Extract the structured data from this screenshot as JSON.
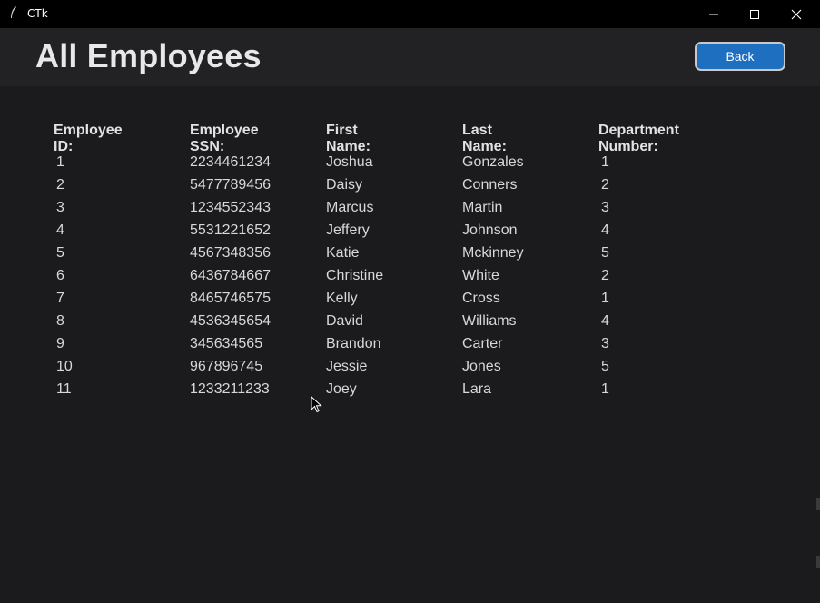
{
  "window": {
    "title": "CTk"
  },
  "header": {
    "title": "All Employees",
    "back_label": "Back"
  },
  "table": {
    "columns": [
      "Employee ID:",
      "Employee SSN:",
      "First Name:",
      "Last Name:",
      "Department Number:"
    ],
    "rows": [
      [
        "1",
        "2234461234",
        "Joshua",
        "Gonzales",
        "1"
      ],
      [
        "2",
        "5477789456",
        "Daisy",
        "Conners",
        "2"
      ],
      [
        "3",
        "1234552343",
        "Marcus",
        "Martin",
        "3"
      ],
      [
        "4",
        "5531221652",
        "Jeffery",
        "Johnson",
        "4"
      ],
      [
        "5",
        "4567348356",
        "Katie",
        "Mckinney",
        "5"
      ],
      [
        "6",
        "6436784667",
        "Christine",
        "White",
        "2"
      ],
      [
        "7",
        "8465746575",
        "Kelly",
        "Cross",
        "1"
      ],
      [
        "8",
        "4536345654",
        "David",
        "Williams",
        "4"
      ],
      [
        "9",
        "345634565",
        "Brandon",
        "Carter",
        "3"
      ],
      [
        "10",
        "967896745",
        "Jessie",
        "Jones",
        "5"
      ],
      [
        "11",
        "1233211233",
        "Joey",
        "Lara",
        "1"
      ]
    ]
  },
  "colors": {
    "background": "#1b1b1d",
    "header": "#222224",
    "accent": "#1f6fc1"
  }
}
